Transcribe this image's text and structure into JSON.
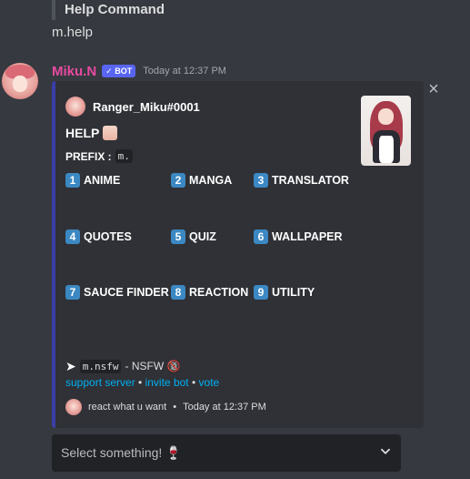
{
  "previous_message": {
    "quote_text": "Help Command",
    "text": "m.help"
  },
  "message": {
    "username": "Miku.N",
    "bot_tag": "✓ BOT",
    "timestamp": "Today at 12:37 PM",
    "username_color": "#e64ba0"
  },
  "embed": {
    "accent_color": "#3a3ea8",
    "author": "Ranger_Miku#0001",
    "title": "HELP",
    "prefix_label": "PREFIX :",
    "prefix_value": "m.",
    "categories": [
      {
        "num": "1",
        "label": "ANIME"
      },
      {
        "num": "2",
        "label": "MANGA"
      },
      {
        "num": "3",
        "label": "TRANSLATOR"
      },
      {
        "num": "4",
        "label": "QUOTES"
      },
      {
        "num": "5",
        "label": "QUIZ"
      },
      {
        "num": "6",
        "label": "WALLPAPER"
      },
      {
        "num": "7",
        "label": "SAUCE FINDER"
      },
      {
        "num": "8",
        "label": "REACTION"
      },
      {
        "num": "9",
        "label": "UTILITY"
      }
    ],
    "nsfw_code": "m.nsfw",
    "nsfw_text": "- NSFW 🔞",
    "links": {
      "support": "support server",
      "invite": "invite bot",
      "vote": "vote",
      "separator": "•"
    },
    "footer_text": "react what u want",
    "footer_time": "Today at 12:37 PM"
  },
  "select": {
    "placeholder": "Select something! 🍷"
  },
  "icons": {
    "close": "close-icon",
    "chevron": "chevron-down-icon",
    "arrow": "arrow-right-icon"
  }
}
